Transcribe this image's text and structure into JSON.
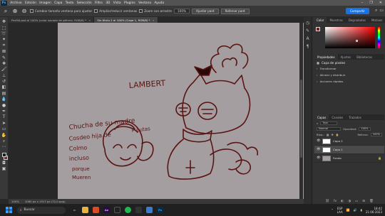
{
  "menu": [
    "Archivo",
    "Edición",
    "Imagen",
    "Capa",
    "Texto",
    "Selección",
    "Filtro",
    "3D",
    "Vista",
    "Plugins",
    "Ventana",
    "Ayuda"
  ],
  "options": {
    "tool_icon": "✕",
    "chk1": "Cambiar tamaño ventana para ajustar",
    "chk2": "Ampliar/reducir ventanas",
    "chk3": "Zoom con arrastre",
    "zoom_field": "100%",
    "btn1": "Ajustar pant",
    "btn2": "Rellenar pant",
    "share": "Compartir"
  },
  "tabs": [
    {
      "label": "Perfil4.psd al 100% (color sacado de género, RGB/8) *",
      "close": "×"
    },
    {
      "label": "Sin título-1 al 100% (Capa 1, RGB/8) *",
      "close": "×"
    }
  ],
  "drawing": {
    "lambert": "LAMBERT",
    "line1": "Chucha de su madre",
    "line2": "Cosdeo hija de",
    "line3": "P putas",
    "line4": "Colmo",
    "line5": "incluso",
    "line6": "porque",
    "line7": "Mueren"
  },
  "statusbar": {
    "zoom": "100%",
    "docinfo": "1080 px x 1917 px (72,0 ppp)"
  },
  "panels": {
    "color_tabs": [
      "Color",
      "Muestras",
      "Degradados",
      "Motivos"
    ],
    "properties_tabs": [
      "Propiedades",
      "Ajustes",
      "Bibliotecas"
    ],
    "properties_title": "Capa de píxeles",
    "properties_items": [
      "Transformar",
      "Alinear y distribuir",
      "Acciones rápidas"
    ],
    "layers_tabs": [
      "Capas",
      "Canales",
      "Trazados"
    ],
    "filter_label": "Tipo",
    "blend_mode": "Normal",
    "opacity_label": "Opacidad:",
    "opacity_value": "100%",
    "lock_label": "Bloq.:",
    "fill_label": "Relleno:",
    "fill_value": "100%",
    "layers": [
      {
        "name": "Capa 2",
        "active": false,
        "kind": "white"
      },
      {
        "name": "Capa 1",
        "active": true,
        "kind": "white"
      },
      {
        "name": "Fondo",
        "active": false,
        "kind": "bg"
      }
    ]
  },
  "taskbar": {
    "search": "Buscar",
    "lang1": "ESP",
    "lang2": "LAA",
    "time": "18:42",
    "date": "21-06-2023",
    "apps": [
      {
        "name": "Ae",
        "color": "#2a0a4a"
      },
      {
        "name": "Sp",
        "color": "#1db954"
      },
      {
        "name": "Ps",
        "color": "#0b2a44"
      }
    ]
  },
  "colors": {
    "ink": "#5a1414",
    "canvas": "#a59ea0",
    "accent": "#1473e6"
  }
}
